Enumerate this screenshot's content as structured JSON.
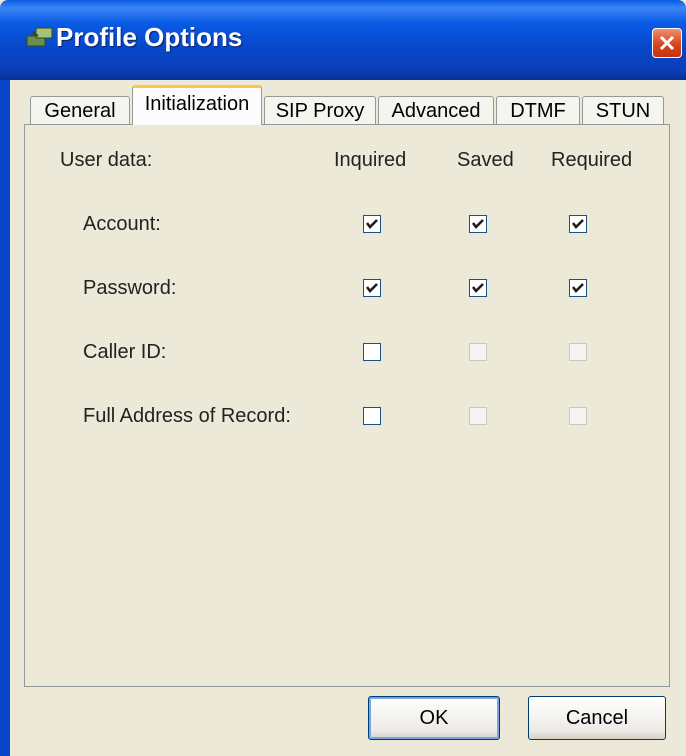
{
  "window": {
    "title": "Profile Options"
  },
  "tabs": [
    {
      "label": "General",
      "active": false
    },
    {
      "label": "Initialization",
      "active": true
    },
    {
      "label": "SIP Proxy",
      "active": false
    },
    {
      "label": "Advanced",
      "active": false
    },
    {
      "label": "DTMF",
      "active": false
    },
    {
      "label": "STUN",
      "active": false
    }
  ],
  "panel": {
    "section_label": "User data:",
    "columns": [
      "Inquired",
      "Saved",
      "Required"
    ],
    "rows": [
      {
        "label": "Account:",
        "inquired": true,
        "saved": true,
        "required": true,
        "saved_enabled": true,
        "required_enabled": true
      },
      {
        "label": "Password:",
        "inquired": true,
        "saved": true,
        "required": true,
        "saved_enabled": true,
        "required_enabled": true
      },
      {
        "label": "Caller ID:",
        "inquired": false,
        "saved": false,
        "required": false,
        "saved_enabled": false,
        "required_enabled": false
      },
      {
        "label": "Full Address of Record:",
        "inquired": false,
        "saved": false,
        "required": false,
        "saved_enabled": false,
        "required_enabled": false
      }
    ]
  },
  "buttons": {
    "ok_label": "OK",
    "cancel_label": "Cancel"
  },
  "colors": {
    "titlebar": "#0A5BE6",
    "dialog_bg": "#ECE9D8",
    "active_tab_accent": "#FFC83C"
  }
}
